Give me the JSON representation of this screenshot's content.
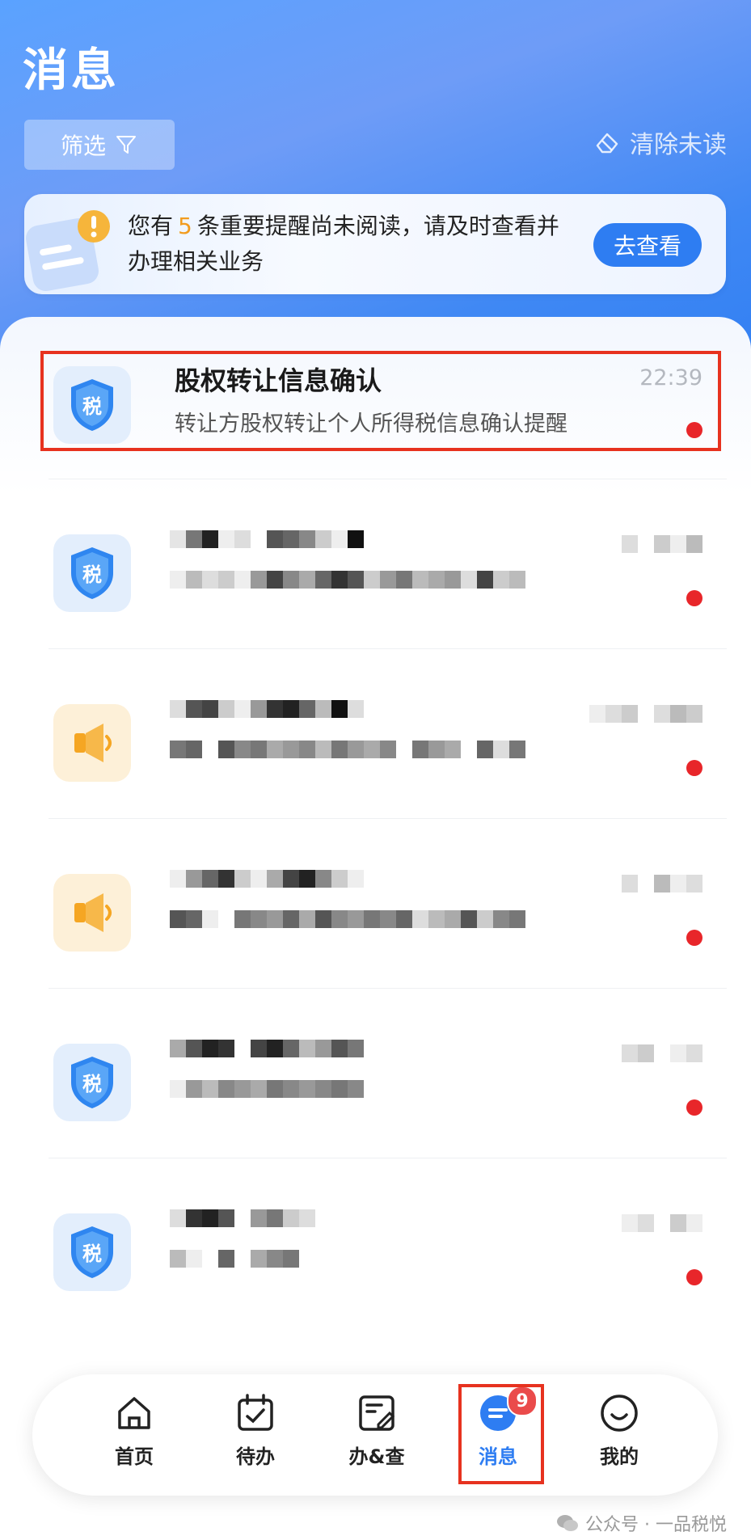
{
  "header": {
    "title": "消息",
    "filter_label": "筛选",
    "clear_unread_label": "清除未读"
  },
  "alert": {
    "prefix": "您有",
    "count": "5",
    "suffix": "条重要提醒尚未阅读，请及时查看并办理相关业务",
    "button_label": "去查看"
  },
  "messages": [
    {
      "icon": "tax-shield-icon",
      "title": "股权转让信息确认",
      "desc": "转让方股权转让个人所得税信息确认提醒",
      "time": "22:39",
      "unread": true
    },
    {
      "icon": "tax-shield-icon",
      "title": "",
      "desc": "",
      "time": "",
      "unread": true,
      "redacted": true
    },
    {
      "icon": "megaphone-icon",
      "title": "",
      "desc": "",
      "time": "",
      "unread": true,
      "redacted": true
    },
    {
      "icon": "megaphone-icon",
      "title": "",
      "desc": "",
      "time": "",
      "unread": true,
      "redacted": true
    },
    {
      "icon": "tax-shield-icon",
      "title": "",
      "desc": "",
      "time": "",
      "unread": true,
      "redacted": true
    },
    {
      "icon": "tax-shield-icon",
      "title": "",
      "desc": "",
      "time": "",
      "unread": true,
      "redacted": true
    }
  ],
  "tax_icon_char": "税",
  "tabbar": {
    "items": [
      {
        "label": "首页",
        "icon": "home-icon"
      },
      {
        "label": "待办",
        "icon": "calendar-check-icon"
      },
      {
        "label": "办&查",
        "icon": "document-edit-icon"
      },
      {
        "label": "消息",
        "icon": "message-icon",
        "badge": "9",
        "active": true
      },
      {
        "label": "我的",
        "icon": "smile-icon"
      }
    ]
  },
  "watermark": "公众号 · 一品税悦",
  "colors": {
    "primary": "#2e7df2",
    "accent_orange": "#f29c1f",
    "unread_dot": "#e8262a",
    "highlight": "#e7321f"
  }
}
